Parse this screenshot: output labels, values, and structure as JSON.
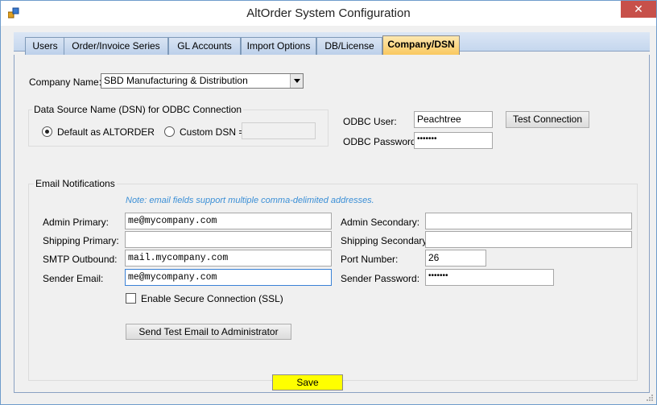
{
  "window": {
    "title": "AltOrder System Configuration",
    "close_glyph": "✕"
  },
  "tabs": [
    {
      "label": "Users"
    },
    {
      "label": "Order/Invoice Series"
    },
    {
      "label": "GL Accounts"
    },
    {
      "label": "Import Options"
    },
    {
      "label": "DB/License"
    },
    {
      "label": "Company/DSN"
    }
  ],
  "active_tab": "Company/DSN",
  "company": {
    "label": "Company Name:",
    "selected": "SBD Manufacturing & Distribution"
  },
  "dsn": {
    "group_title": "Data Source Name (DSN) for ODBC Connection",
    "default_label": "Default as ALTORDER",
    "custom_label": "Custom DSN =",
    "custom_value": "",
    "selected": "default"
  },
  "odbc": {
    "user_label": "ODBC User:",
    "user_value": "Peachtree",
    "password_label": "ODBC Password:",
    "password_value": "•••••••",
    "test_button": "Test Connection"
  },
  "email": {
    "group_title": "Email Notifications",
    "note": "Note: email fields support multiple comma-delimited addresses.",
    "admin_primary_label": "Admin Primary:",
    "admin_primary_value": "me@mycompany.com",
    "admin_secondary_label": "Admin Secondary:",
    "admin_secondary_value": "",
    "shipping_primary_label": "Shipping Primary:",
    "shipping_primary_value": "",
    "shipping_secondary_label": "Shipping Secondary:",
    "shipping_secondary_value": "",
    "smtp_label": "SMTP Outbound:",
    "smtp_value": "mail.mycompany.com",
    "port_label": "Port Number:",
    "port_value": "26",
    "sender_email_label": "Sender Email:",
    "sender_email_value": "me@mycompany.com",
    "sender_password_label": "Sender Password:",
    "sender_password_value": "•••••••",
    "ssl_label": "Enable Secure Connection (SSL)",
    "ssl_checked": false,
    "test_email_button": "Send Test Email to Administrator"
  },
  "footer": {
    "save_label": "Save"
  },
  "colors": {
    "save_button": "#ffff00",
    "active_tab": "#f9c75c",
    "close_button": "#c7504a",
    "note_text": "#3b8fd6"
  }
}
